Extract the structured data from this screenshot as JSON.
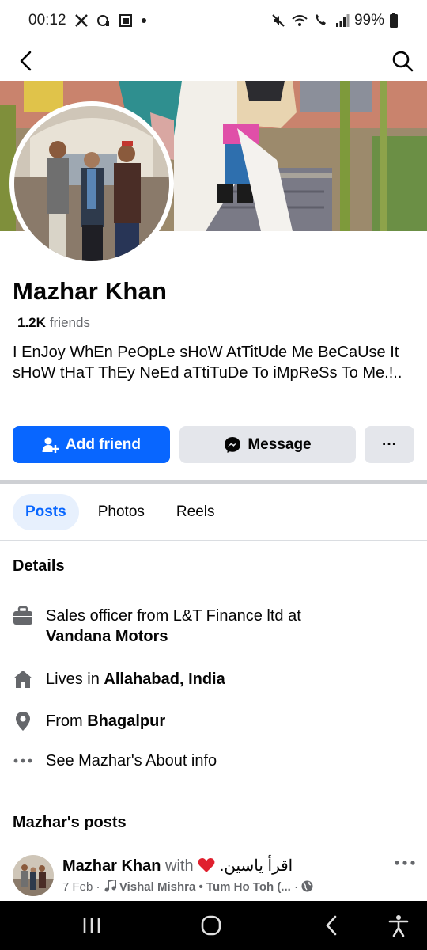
{
  "status_bar": {
    "time": "00:12",
    "battery": "99%"
  },
  "profile": {
    "name": "Mazhar Khan",
    "friends_count": "1.2K",
    "friends_label": "friends",
    "bio": "I EnJoy WhEn PeOpLe sHoW AtTitUde Me BeCaUse It sHoW tHaT ThEy NeEd aTtiTuDe To iMpReSs To Me.!.."
  },
  "actions": {
    "add_friend": "Add friend",
    "message": "Message",
    "more": "···"
  },
  "tabs": [
    {
      "label": "Posts",
      "active": true
    },
    {
      "label": "Photos",
      "active": false
    },
    {
      "label": "Reels",
      "active": false
    }
  ],
  "details": {
    "title": "Details",
    "work_prefix": "Sales officer from L&T Finance ltd at",
    "work_place": "Vandana Motors",
    "lives_prefix": "Lives in",
    "lives_place": "Allahabad, India",
    "from_prefix": "From",
    "from_place": "Bhagalpur",
    "about": "See Mazhar's About info"
  },
  "posts": {
    "title": "Mazhar's posts",
    "first": {
      "author": "Mazhar Khan",
      "with_label": "with",
      "tagged": "اقرأ یاسین.",
      "date": "7 Feb",
      "music": "Vishal Mishra • Tum Ho Toh (...",
      "separator": "·"
    }
  },
  "colors": {
    "accent": "#0866ff",
    "tab_active_bg": "#e7f0fd",
    "secondary_button": "#e4e6eb",
    "muted_text": "#65676b"
  }
}
